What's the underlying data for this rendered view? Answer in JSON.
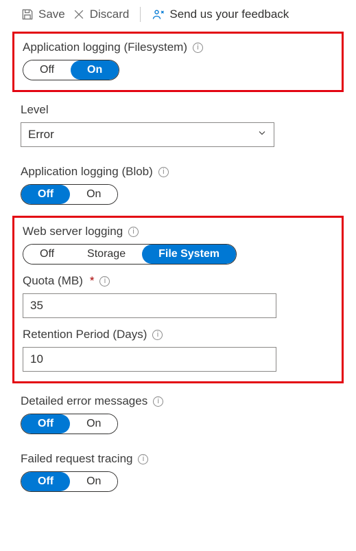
{
  "toolbar": {
    "save_label": "Save",
    "discard_label": "Discard",
    "feedback_label": "Send us your feedback"
  },
  "app_logging_fs": {
    "label": "Application logging (Filesystem)",
    "options": {
      "off": "Off",
      "on": "On"
    },
    "selected": "on"
  },
  "level": {
    "label": "Level",
    "value": "Error"
  },
  "app_logging_blob": {
    "label": "Application logging (Blob)",
    "options": {
      "off": "Off",
      "on": "On"
    },
    "selected": "off"
  },
  "web_server_logging": {
    "label": "Web server logging",
    "options": {
      "off": "Off",
      "storage": "Storage",
      "fs": "File System"
    },
    "selected": "fs"
  },
  "quota": {
    "label": "Quota (MB)",
    "required_marker": "*",
    "value": "35"
  },
  "retention": {
    "label": "Retention Period (Days)",
    "value": "10"
  },
  "detailed_errors": {
    "label": "Detailed error messages",
    "options": {
      "off": "Off",
      "on": "On"
    },
    "selected": "off"
  },
  "failed_request": {
    "label": "Failed request tracing",
    "options": {
      "off": "Off",
      "on": "On"
    },
    "selected": "off"
  }
}
